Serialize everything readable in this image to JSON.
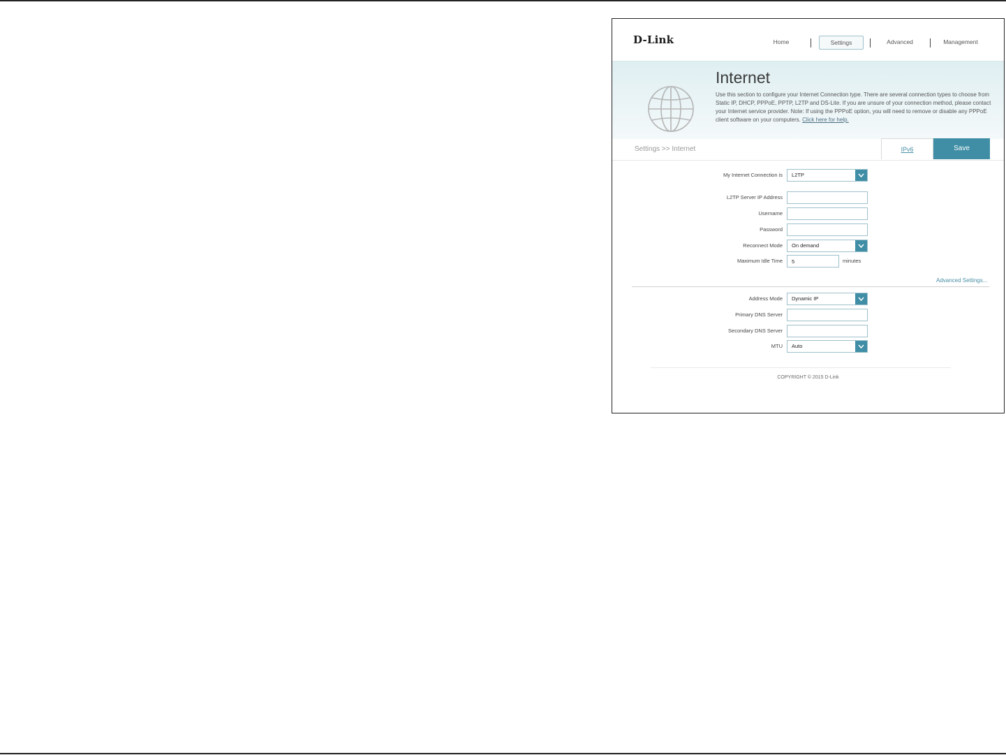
{
  "header": {
    "logo": "D-Link",
    "nav": [
      {
        "label": "Home",
        "active": false
      },
      {
        "label": "Settings",
        "active": true
      },
      {
        "label": "Advanced",
        "active": false
      },
      {
        "label": "Management",
        "active": false
      }
    ]
  },
  "banner": {
    "title": "Internet",
    "description": "Use this section to configure your Internet Connection type. There are several connection types to choose from Static IP, DHCP, PPPoE, PPTP, L2TP and DS-Lite. If you are unsure of your connection method, please contact your Internet service provider. Note: If using the PPPoE option, you will need to remove or disable any PPPoE client software on your computers.",
    "help_link": "Click here for help."
  },
  "toolbar": {
    "breadcrumb": "Settings >> Internet",
    "ipv6_label": "IPv6",
    "save_label": "Save"
  },
  "form": {
    "connection": {
      "label": "My Internet Connection is",
      "value": "L2TP"
    },
    "server_ip": {
      "label": "L2TP Server IP Address",
      "value": ""
    },
    "username": {
      "label": "Username",
      "value": ""
    },
    "password": {
      "label": "Password",
      "value": ""
    },
    "reconnect": {
      "label": "Reconnect Mode",
      "value": "On demand"
    },
    "idle_time": {
      "label": "Maximum Idle Time",
      "value": "5",
      "unit": "minutes"
    },
    "advanced_link": "Advanced Settings...",
    "address_mode": {
      "label": "Address Mode",
      "value": "Dynamic IP"
    },
    "primary_dns": {
      "label": "Primary DNS Server",
      "value": ""
    },
    "secondary_dns": {
      "label": "Secondary DNS Server",
      "value": ""
    },
    "mtu": {
      "label": "MTU",
      "value": "Auto"
    }
  },
  "footer": {
    "copyright": "COPYRIGHT © 2015 D-Link"
  },
  "colors": {
    "accent": "#3f8ea5",
    "field_border": "#9ec1cc",
    "banner_bg": "#e3f1f4"
  }
}
